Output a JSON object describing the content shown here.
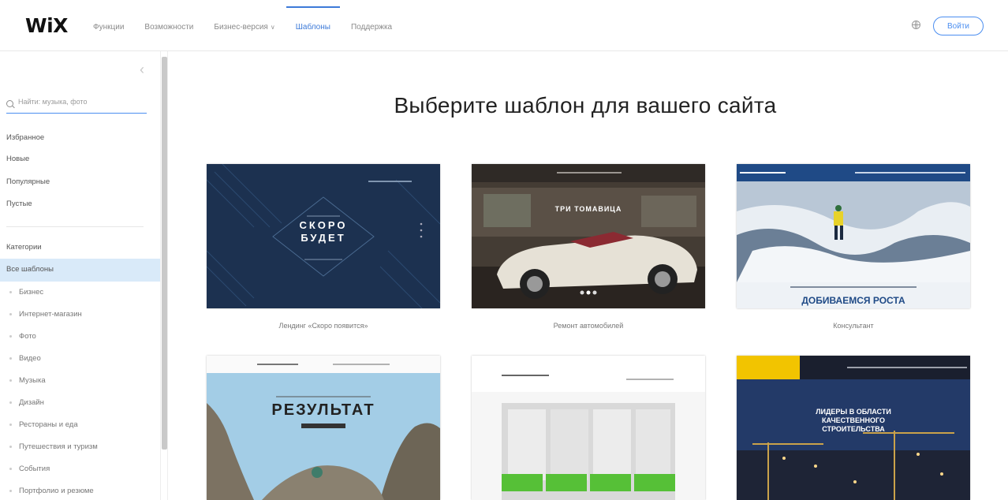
{
  "header": {
    "logo": "WiX",
    "nav": [
      "Функции",
      "Возможности",
      "Бизнес-версия",
      "Шаблоны",
      "Поддержка"
    ],
    "active_nav": "Шаблоны",
    "login_label": "Войти"
  },
  "sidebar": {
    "search_placeholder": "Найти: музыка, фото",
    "quick_links": [
      "Избранное",
      "Новые",
      "Популярные",
      "Пустые"
    ],
    "categories_heading": "Категории",
    "active_item": "Все шаблоны",
    "subcategories": [
      "Бизнес",
      "Интернет-магазин",
      "Фото",
      "Видео",
      "Музыка",
      "Дизайн",
      "Рестораны и еда",
      "Путешествия и туризм",
      "События",
      "Портфолио и резюме"
    ]
  },
  "main": {
    "title": "Выберите шаблон для вашего сайта",
    "templates": [
      {
        "label": "Лендинг «Скоро появится»",
        "thumb_text": [
          "СКОРО",
          "БУДЕТ"
        ]
      },
      {
        "label": "Ремонт автомобилей",
        "thumb_text": [
          "ТРИ ТОМАВИЦА"
        ]
      },
      {
        "label": "Консультант",
        "thumb_text": [
          "ДОБИВАЕМСЯ РОСТА"
        ]
      },
      {
        "label": "",
        "thumb_text": [
          "РЕЗУЛЬТАТ"
        ]
      },
      {
        "label": "",
        "thumb_text": []
      },
      {
        "label": "",
        "thumb_text": [
          "ЛИДЕРЫ В ОБЛАСТИ",
          "КАЧЕСТВЕННОГО",
          "СТРОИТЕЛЬСТВА"
        ]
      }
    ]
  },
  "colors": {
    "accent": "#3d7ad8",
    "active_bg": "#d9eaf9"
  }
}
